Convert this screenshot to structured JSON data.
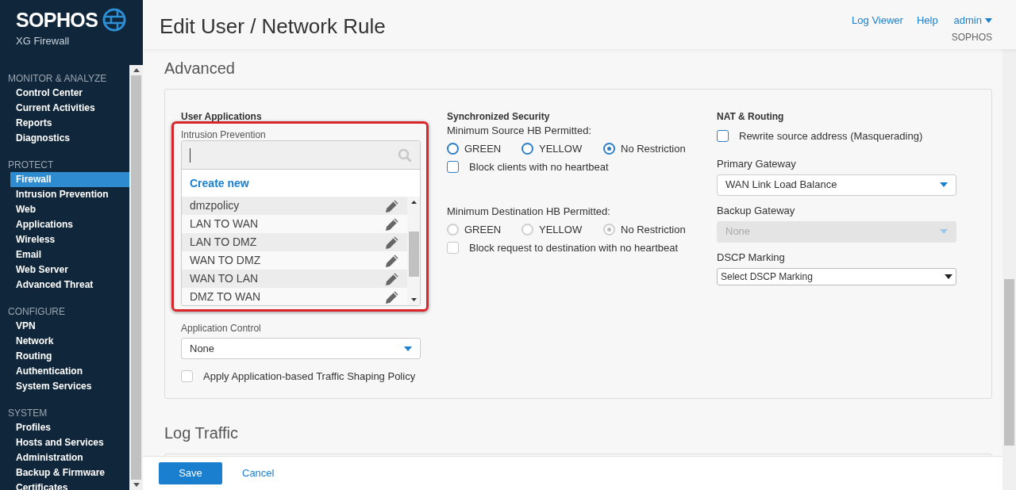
{
  "brand": {
    "name": "SOPHOS",
    "product": "XG Firewall"
  },
  "sidebar": {
    "sections": [
      {
        "title": "MONITOR & ANALYZE",
        "items": [
          {
            "label": "Control Center",
            "selected": false
          },
          {
            "label": "Current Activities",
            "selected": false
          },
          {
            "label": "Reports",
            "selected": false
          },
          {
            "label": "Diagnostics",
            "selected": false
          }
        ]
      },
      {
        "title": "PROTECT",
        "items": [
          {
            "label": "Firewall",
            "selected": true
          },
          {
            "label": "Intrusion Prevention",
            "selected": false
          },
          {
            "label": "Web",
            "selected": false
          },
          {
            "label": "Applications",
            "selected": false
          },
          {
            "label": "Wireless",
            "selected": false
          },
          {
            "label": "Email",
            "selected": false
          },
          {
            "label": "Web Server",
            "selected": false
          },
          {
            "label": "Advanced Threat",
            "selected": false
          }
        ]
      },
      {
        "title": "CONFIGURE",
        "items": [
          {
            "label": "VPN",
            "selected": false
          },
          {
            "label": "Network",
            "selected": false
          },
          {
            "label": "Routing",
            "selected": false
          },
          {
            "label": "Authentication",
            "selected": false
          },
          {
            "label": "System Services",
            "selected": false
          }
        ]
      },
      {
        "title": "SYSTEM",
        "items": [
          {
            "label": "Profiles",
            "selected": false
          },
          {
            "label": "Hosts and Services",
            "selected": false
          },
          {
            "label": "Administration",
            "selected": false
          },
          {
            "label": "Backup & Firmware",
            "selected": false
          },
          {
            "label": "Certificates",
            "selected": false
          }
        ]
      }
    ]
  },
  "header": {
    "title": "Edit User / Network Rule",
    "links": [
      "Log Viewer",
      "Help"
    ],
    "user": "admin",
    "org": "SOPHOS"
  },
  "advanced": {
    "title": "Advanced",
    "user_applications": {
      "title": "User Applications",
      "intrusion_label": "Intrusion Prevention",
      "dropdown": {
        "create_new": "Create new",
        "options": [
          {
            "label": "dmzpolicy"
          },
          {
            "label": "LAN TO WAN"
          },
          {
            "label": "LAN TO DMZ"
          },
          {
            "label": "WAN TO DMZ"
          },
          {
            "label": "WAN TO LAN"
          },
          {
            "label": "DMZ TO WAN"
          }
        ]
      },
      "app_control": {
        "label": "Application Control",
        "value": "None"
      },
      "shaping": {
        "label": "Apply Application-based Traffic Shaping Policy",
        "checked": false
      }
    },
    "sync_security": {
      "title": "Synchronized Security",
      "groups": [
        {
          "label": "Minimum Source HB Permitted:",
          "disabled": false,
          "options": [
            {
              "label": "GREEN",
              "selected": false
            },
            {
              "label": "YELLOW",
              "selected": false
            },
            {
              "label": "No Restriction",
              "selected": true
            }
          ],
          "checkbox": {
            "label": "Block clients with no heartbeat",
            "checked": false
          }
        },
        {
          "label": "Minimum Destination HB Permitted:",
          "disabled": true,
          "options": [
            {
              "label": "GREEN",
              "selected": false
            },
            {
              "label": "YELLOW",
              "selected": false
            },
            {
              "label": "No Restriction",
              "selected": true
            }
          ],
          "checkbox": {
            "label": "Block request to destination with no heartbeat",
            "checked": false
          }
        }
      ]
    },
    "nat": {
      "title": "NAT & Routing",
      "masquerade": {
        "label": "Rewrite source address (Masquerading)",
        "checked": false
      },
      "primary": {
        "label": "Primary Gateway",
        "value": "WAN Link Load Balance",
        "disabled": false
      },
      "backup": {
        "label": "Backup Gateway",
        "value": "None",
        "disabled": true
      },
      "dscp": {
        "label": "DSCP Marking",
        "value": "Select DSCP Marking"
      }
    }
  },
  "log_traffic": {
    "title": "Log Traffic"
  },
  "footer": {
    "save": "Save",
    "cancel": "Cancel"
  }
}
